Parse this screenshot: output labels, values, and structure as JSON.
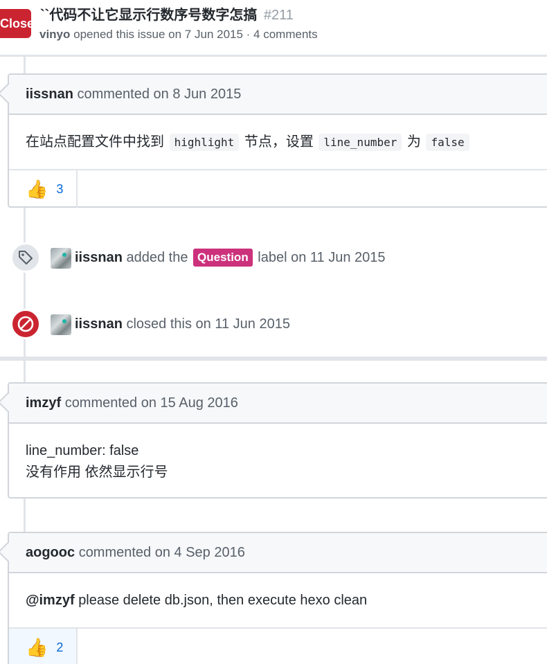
{
  "header": {
    "state": "Closed",
    "title": "``代码不让它显示行数序号数字怎搞",
    "number": "#211",
    "author": "vinyo",
    "opened_text": "opened this issue on 7 Jun 2015 · 4 comments"
  },
  "comments": [
    {
      "author": "iissnan",
      "date_text": "commented on 8 Jun 2015",
      "body": {
        "t1": "在站点配置文件中找到",
        "c1": "highlight",
        "t2": "节点，设置",
        "c2": "line_number",
        "t3": "为",
        "c3": "false"
      },
      "reaction": {
        "icon": "thumbs-up",
        "emoji": "👍",
        "count": "3"
      }
    },
    {
      "author": "imzyf",
      "date_text": "commented on 15 Aug 2016",
      "body": {
        "line1": "line_number: false",
        "line2": "没有作用 依然显示行号"
      }
    },
    {
      "author": "aogooc",
      "date_text": "commented on 4 Sep 2016",
      "body": {
        "mention": "@imzyf",
        "text": "please delete db.json, then execute hexo clean"
      },
      "reaction": {
        "icon": "thumbs-up",
        "emoji": "👍",
        "count": "2"
      }
    }
  ],
  "events": {
    "labeled": {
      "actor": "iissnan",
      "pre": "added the",
      "label": "Question",
      "post": "label on 11 Jun 2015",
      "label_color": "#cc317c"
    },
    "closed": {
      "actor": "iissnan",
      "text": "closed this on 11 Jun 2015"
    }
  },
  "colors": {
    "closed": "#cb2431",
    "link": "#0366d6",
    "border": "#d1d5da"
  }
}
